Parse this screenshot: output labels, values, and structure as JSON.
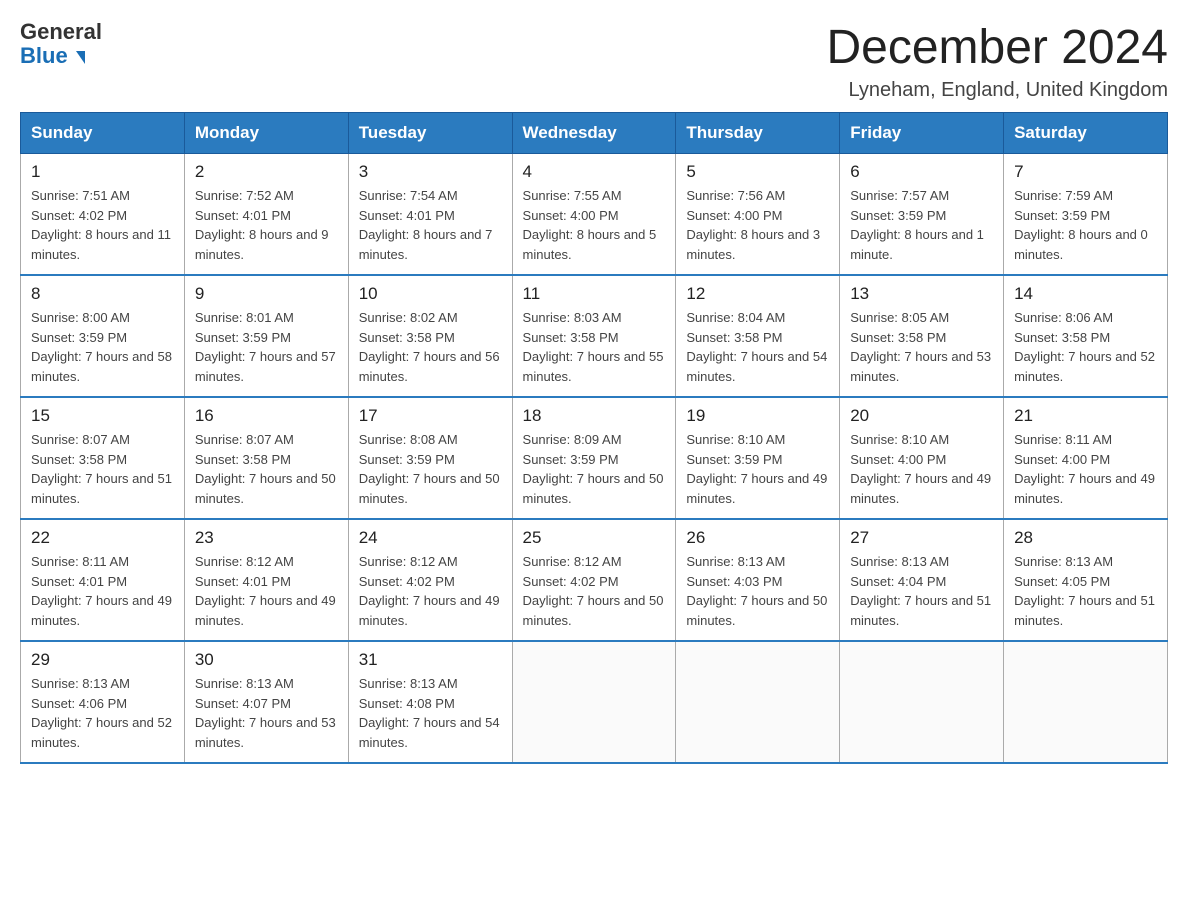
{
  "header": {
    "logo_general": "General",
    "logo_blue": "Blue",
    "month_title": "December 2024",
    "location": "Lyneham, England, United Kingdom"
  },
  "calendar": {
    "days_of_week": [
      "Sunday",
      "Monday",
      "Tuesday",
      "Wednesday",
      "Thursday",
      "Friday",
      "Saturday"
    ],
    "weeks": [
      [
        {
          "day": "1",
          "sunrise": "7:51 AM",
          "sunset": "4:02 PM",
          "daylight": "8 hours and 11 minutes."
        },
        {
          "day": "2",
          "sunrise": "7:52 AM",
          "sunset": "4:01 PM",
          "daylight": "8 hours and 9 minutes."
        },
        {
          "day": "3",
          "sunrise": "7:54 AM",
          "sunset": "4:01 PM",
          "daylight": "8 hours and 7 minutes."
        },
        {
          "day": "4",
          "sunrise": "7:55 AM",
          "sunset": "4:00 PM",
          "daylight": "8 hours and 5 minutes."
        },
        {
          "day": "5",
          "sunrise": "7:56 AM",
          "sunset": "4:00 PM",
          "daylight": "8 hours and 3 minutes."
        },
        {
          "day": "6",
          "sunrise": "7:57 AM",
          "sunset": "3:59 PM",
          "daylight": "8 hours and 1 minute."
        },
        {
          "day": "7",
          "sunrise": "7:59 AM",
          "sunset": "3:59 PM",
          "daylight": "8 hours and 0 minutes."
        }
      ],
      [
        {
          "day": "8",
          "sunrise": "8:00 AM",
          "sunset": "3:59 PM",
          "daylight": "7 hours and 58 minutes."
        },
        {
          "day": "9",
          "sunrise": "8:01 AM",
          "sunset": "3:59 PM",
          "daylight": "7 hours and 57 minutes."
        },
        {
          "day": "10",
          "sunrise": "8:02 AM",
          "sunset": "3:58 PM",
          "daylight": "7 hours and 56 minutes."
        },
        {
          "day": "11",
          "sunrise": "8:03 AM",
          "sunset": "3:58 PM",
          "daylight": "7 hours and 55 minutes."
        },
        {
          "day": "12",
          "sunrise": "8:04 AM",
          "sunset": "3:58 PM",
          "daylight": "7 hours and 54 minutes."
        },
        {
          "day": "13",
          "sunrise": "8:05 AM",
          "sunset": "3:58 PM",
          "daylight": "7 hours and 53 minutes."
        },
        {
          "day": "14",
          "sunrise": "8:06 AM",
          "sunset": "3:58 PM",
          "daylight": "7 hours and 52 minutes."
        }
      ],
      [
        {
          "day": "15",
          "sunrise": "8:07 AM",
          "sunset": "3:58 PM",
          "daylight": "7 hours and 51 minutes."
        },
        {
          "day": "16",
          "sunrise": "8:07 AM",
          "sunset": "3:58 PM",
          "daylight": "7 hours and 50 minutes."
        },
        {
          "day": "17",
          "sunrise": "8:08 AM",
          "sunset": "3:59 PM",
          "daylight": "7 hours and 50 minutes."
        },
        {
          "day": "18",
          "sunrise": "8:09 AM",
          "sunset": "3:59 PM",
          "daylight": "7 hours and 50 minutes."
        },
        {
          "day": "19",
          "sunrise": "8:10 AM",
          "sunset": "3:59 PM",
          "daylight": "7 hours and 49 minutes."
        },
        {
          "day": "20",
          "sunrise": "8:10 AM",
          "sunset": "4:00 PM",
          "daylight": "7 hours and 49 minutes."
        },
        {
          "day": "21",
          "sunrise": "8:11 AM",
          "sunset": "4:00 PM",
          "daylight": "7 hours and 49 minutes."
        }
      ],
      [
        {
          "day": "22",
          "sunrise": "8:11 AM",
          "sunset": "4:01 PM",
          "daylight": "7 hours and 49 minutes."
        },
        {
          "day": "23",
          "sunrise": "8:12 AM",
          "sunset": "4:01 PM",
          "daylight": "7 hours and 49 minutes."
        },
        {
          "day": "24",
          "sunrise": "8:12 AM",
          "sunset": "4:02 PM",
          "daylight": "7 hours and 49 minutes."
        },
        {
          "day": "25",
          "sunrise": "8:12 AM",
          "sunset": "4:02 PM",
          "daylight": "7 hours and 50 minutes."
        },
        {
          "day": "26",
          "sunrise": "8:13 AM",
          "sunset": "4:03 PM",
          "daylight": "7 hours and 50 minutes."
        },
        {
          "day": "27",
          "sunrise": "8:13 AM",
          "sunset": "4:04 PM",
          "daylight": "7 hours and 51 minutes."
        },
        {
          "day": "28",
          "sunrise": "8:13 AM",
          "sunset": "4:05 PM",
          "daylight": "7 hours and 51 minutes."
        }
      ],
      [
        {
          "day": "29",
          "sunrise": "8:13 AM",
          "sunset": "4:06 PM",
          "daylight": "7 hours and 52 minutes."
        },
        {
          "day": "30",
          "sunrise": "8:13 AM",
          "sunset": "4:07 PM",
          "daylight": "7 hours and 53 minutes."
        },
        {
          "day": "31",
          "sunrise": "8:13 AM",
          "sunset": "4:08 PM",
          "daylight": "7 hours and 54 minutes."
        },
        null,
        null,
        null,
        null
      ]
    ],
    "sunrise_label": "Sunrise:",
    "sunset_label": "Sunset:",
    "daylight_label": "Daylight:"
  }
}
